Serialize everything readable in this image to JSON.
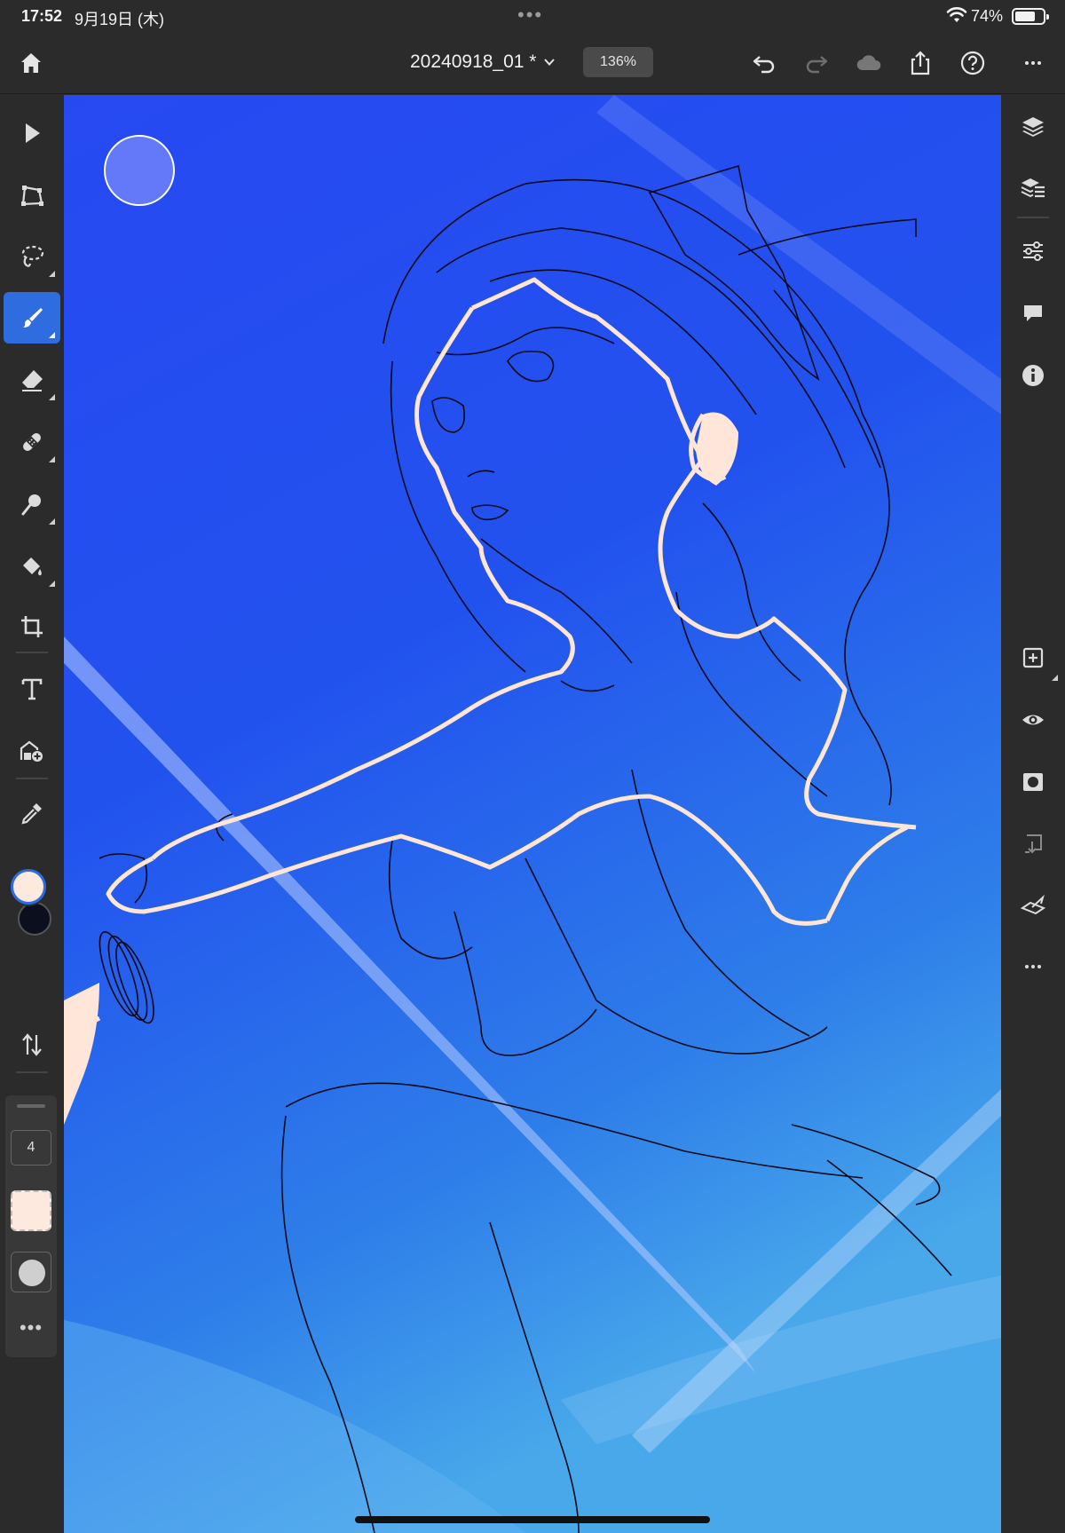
{
  "status_bar": {
    "time": "17:52",
    "date": "9月19日 (木)",
    "battery_percent": "74%",
    "battery_level": 0.74,
    "center_dots": "•••"
  },
  "toolbar": {
    "document_title": "20240918_01 *",
    "zoom_level": "136%",
    "icons": [
      "home-icon",
      "chevron-down-icon",
      "undo-icon",
      "redo-icon",
      "cloud-icon",
      "share-icon",
      "help-icon",
      "more-icon"
    ]
  },
  "left_tools": {
    "items": [
      "select-icon",
      "transform-icon",
      "lasso-icon",
      "brush-icon",
      "eraser-icon",
      "healing-icon",
      "smudge-icon",
      "fill-icon",
      "crop-icon",
      "text-icon",
      "place-image-icon",
      "eyedropper-icon",
      "swap-colors-icon"
    ],
    "active": "brush-icon",
    "foreground_color": "#fde9de",
    "background_color": "#0b0f1e",
    "brush_size": "4",
    "brush_color": "#fde9de",
    "more_label": "•••"
  },
  "right_tools": {
    "items": [
      "layers-icon",
      "layer-properties-icon",
      "adjustments-icon",
      "comments-icon",
      "info-icon",
      "add-layer-icon",
      "visibility-icon",
      "mask-icon",
      "merge-down-icon",
      "clear-icon",
      "more-icon"
    ],
    "more_label": "•••"
  },
  "colors": {
    "ui_background": "#2b2b2b",
    "accent": "#2f6cdf",
    "sky_top": "#2a4df0",
    "sky_bottom": "#3f9be8"
  }
}
